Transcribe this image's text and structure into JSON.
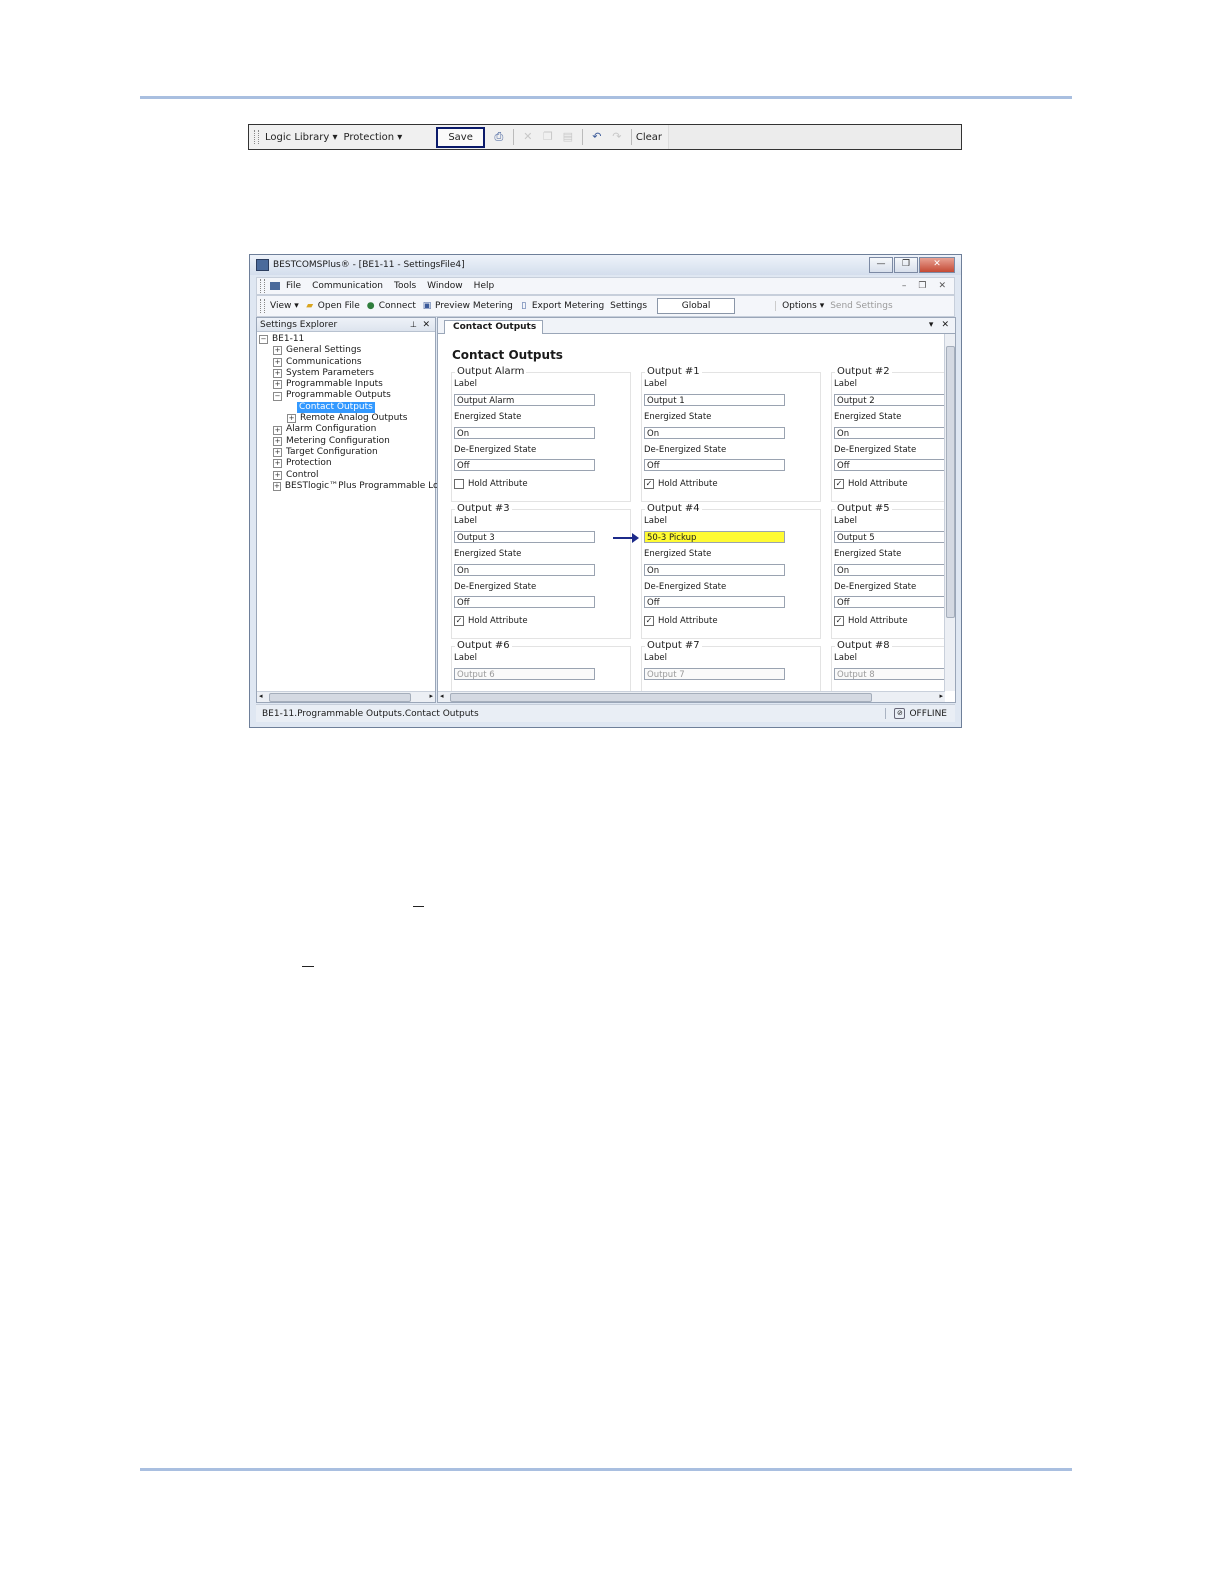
{
  "logic_toolbar": {
    "logic_library": "Logic Library",
    "protection": "Protection",
    "save": "Save",
    "clear": "Clear"
  },
  "window": {
    "title": "BESTCOMSPlus® - [BE1-11 - SettingsFile4]",
    "menu": [
      "File",
      "Communication",
      "Tools",
      "Window",
      "Help"
    ],
    "toolbar": {
      "view": "View",
      "open_file": "Open File",
      "connect": "Connect",
      "preview_metering": "Preview Metering",
      "export_metering": "Export Metering",
      "settings_label": "Settings",
      "settings_value": "Global",
      "options": "Options",
      "send_settings": "Send Settings"
    },
    "explorer": {
      "title": "Settings Explorer",
      "root": "BE1-11",
      "items": [
        "General Settings",
        "Communications",
        "System Parameters",
        "Programmable Inputs",
        "Programmable Outputs",
        "Contact Outputs",
        "Remote Analog Outputs",
        "Alarm Configuration",
        "Metering Configuration",
        "Target Configuration",
        "Protection",
        "Control",
        "BESTlogic™Plus Programmable Logic"
      ]
    },
    "tab_label": "Contact Outputs",
    "page_title": "Contact Outputs",
    "field_labels": {
      "label": "Label",
      "energized": "Energized State",
      "deenergized": "De-Energized State",
      "hold": "Hold Attribute"
    },
    "outputs": [
      {
        "title": "Output Alarm",
        "label": "Output Alarm",
        "energized": "On",
        "deenergized": "Off",
        "hold": false
      },
      {
        "title": "Output #1",
        "label": "Output 1",
        "energized": "On",
        "deenergized": "Off",
        "hold": true
      },
      {
        "title": "Output #2",
        "label": "Output 2",
        "energized": "On",
        "deenergized": "Off",
        "hold": true
      },
      {
        "title": "Output #3",
        "label": "Output 3",
        "energized": "On",
        "deenergized": "Off",
        "hold": true
      },
      {
        "title": "Output #4",
        "label": "50-3 Pickup",
        "energized": "On",
        "deenergized": "Off",
        "hold": true
      },
      {
        "title": "Output #5",
        "label": "Output 5",
        "energized": "On",
        "deenergized": "Off",
        "hold": true
      },
      {
        "title": "Output #6",
        "label": "Output 6"
      },
      {
        "title": "Output #7",
        "label": "Output 7"
      },
      {
        "title": "Output #8",
        "label": "Output 8"
      }
    ],
    "status": {
      "path": "BE1-11.Programmable Outputs.Contact Outputs",
      "state": "OFFLINE"
    }
  },
  "colors": {
    "rule": "#a9bfe0",
    "highlight_field": "#fffb33",
    "selection": "#3399ff",
    "arrow": "#1c2a8a"
  }
}
